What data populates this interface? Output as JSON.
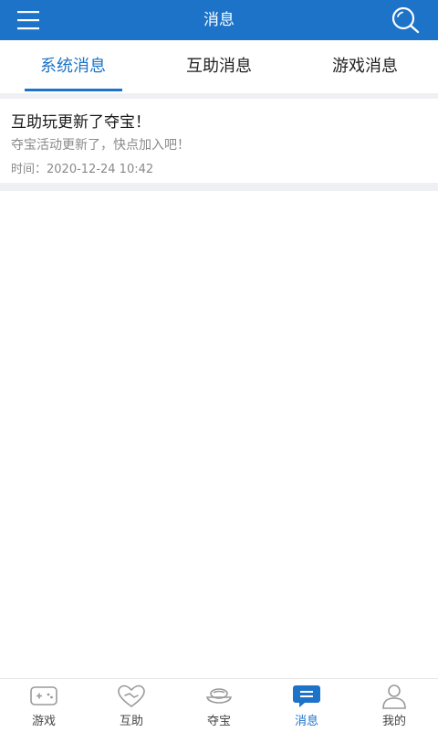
{
  "header": {
    "title": "消息",
    "menu_icon": "hamburger-menu-icon",
    "search_icon": "search-icon",
    "color": "#1c73c8"
  },
  "tabs": [
    {
      "label": "系统消息",
      "active": true
    },
    {
      "label": "互助消息",
      "active": false
    },
    {
      "label": "游戏消息",
      "active": false
    }
  ],
  "messages": [
    {
      "title": "互助玩更新了夺宝！",
      "body": "夺宝活动更新了，快点加入吧！",
      "time": "时间：2020-12-24 10:42"
    }
  ],
  "bottom_nav": [
    {
      "label": "游戏",
      "icon": "gamepad-icon",
      "active": false
    },
    {
      "label": "互助",
      "icon": "handshake-heart-icon",
      "active": false
    },
    {
      "label": "夺宝",
      "icon": "gold-ingot-icon",
      "active": false
    },
    {
      "label": "消息",
      "icon": "message-bubble-icon",
      "active": true
    },
    {
      "label": "我的",
      "icon": "user-icon",
      "active": false
    }
  ],
  "colors": {
    "accent": "#1c73c8",
    "muted_text": "#8a8a8a",
    "divider": "#eef0f4"
  }
}
